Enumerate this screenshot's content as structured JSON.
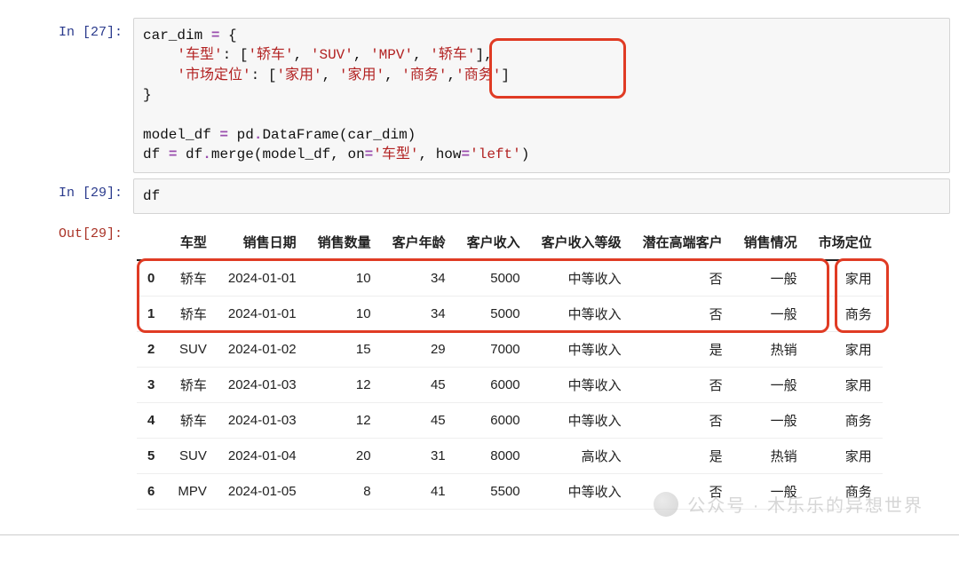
{
  "cells": {
    "in27": {
      "prompt": "In [27]:",
      "line1a": "car_dim ",
      "line1b": "=",
      "line1c": " {",
      "line2a": "    ",
      "line2b": "'车型'",
      "line2c": ": [",
      "line2d": "'轿车'",
      "line2e": ", ",
      "line2f": "'SUV'",
      "line2g": ", ",
      "line2h": "'MPV'",
      "line2i": ", ",
      "line2j": "'轿车'",
      "line2k": "],",
      "line3a": "    ",
      "line3b": "'市场定位'",
      "line3c": ": [",
      "line3d": "'家用'",
      "line3e": ", ",
      "line3f": "'家用'",
      "line3g": ", ",
      "line3h": "'商务'",
      "line3i": ",",
      "line3j": "'商务'",
      "line3k": "]",
      "line4": "}",
      "line5": "",
      "line6a": "model_df ",
      "line6b": "=",
      "line6c": " pd",
      "line6d": ".",
      "line6e": "DataFrame(car_dim)",
      "line7a": "df ",
      "line7b": "=",
      "line7c": " df",
      "line7d": ".",
      "line7e": "merge(model_df, on",
      "line7f": "=",
      "line7g": "'车型'",
      "line7h": ", how",
      "line7i": "=",
      "line7j": "'left'",
      "line7k": ")"
    },
    "in29": {
      "prompt": "In [29]:",
      "code": "df"
    },
    "out29": {
      "prompt": "Out[29]:"
    }
  },
  "table": {
    "columns": [
      "车型",
      "销售日期",
      "销售数量",
      "客户年龄",
      "客户收入",
      "客户收入等级",
      "潜在高端客户",
      "销售情况",
      "市场定位"
    ],
    "rows": [
      {
        "idx": "0",
        "cells": [
          "轿车",
          "2024-01-01",
          "10",
          "34",
          "5000",
          "中等收入",
          "否",
          "一般",
          "家用"
        ]
      },
      {
        "idx": "1",
        "cells": [
          "轿车",
          "2024-01-01",
          "10",
          "34",
          "5000",
          "中等收入",
          "否",
          "一般",
          "商务"
        ]
      },
      {
        "idx": "2",
        "cells": [
          "SUV",
          "2024-01-02",
          "15",
          "29",
          "7000",
          "中等收入",
          "是",
          "热销",
          "家用"
        ]
      },
      {
        "idx": "3",
        "cells": [
          "轿车",
          "2024-01-03",
          "12",
          "45",
          "6000",
          "中等收入",
          "否",
          "一般",
          "家用"
        ]
      },
      {
        "idx": "4",
        "cells": [
          "轿车",
          "2024-01-03",
          "12",
          "45",
          "6000",
          "中等收入",
          "否",
          "一般",
          "商务"
        ]
      },
      {
        "idx": "5",
        "cells": [
          "SUV",
          "2024-01-04",
          "20",
          "31",
          "8000",
          "高收入",
          "是",
          "热销",
          "家用"
        ]
      },
      {
        "idx": "6",
        "cells": [
          "MPV",
          "2024-01-05",
          "8",
          "41",
          "5500",
          "中等收入",
          "否",
          "一般",
          "商务"
        ]
      }
    ]
  },
  "watermark": {
    "text": "公众号 · 木乐乐的异想世界"
  },
  "highlight_colors": {
    "stroke": "#e03b24"
  }
}
